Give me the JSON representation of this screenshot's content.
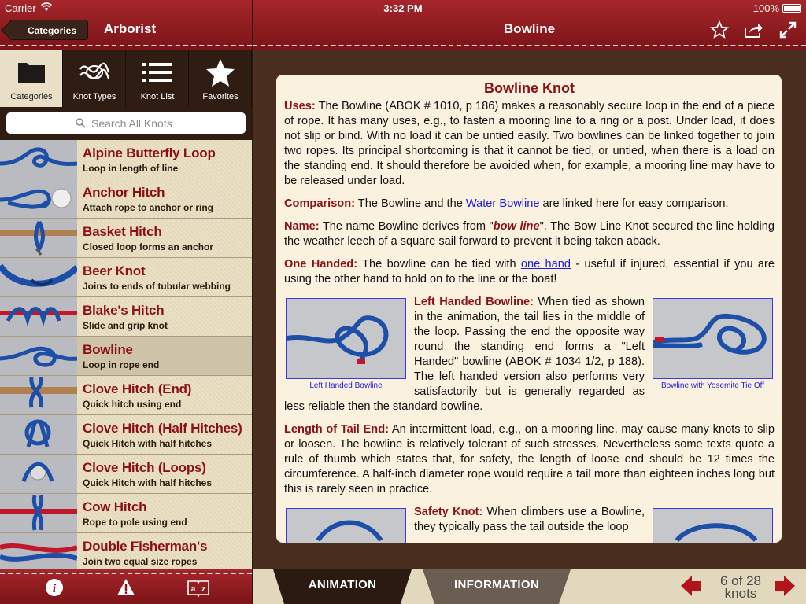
{
  "status": {
    "carrier": "Carrier",
    "time": "3:32 PM",
    "battery": "100%"
  },
  "left_nav": {
    "back_label": "Categories",
    "title": "Arborist"
  },
  "right_nav": {
    "title": "Bowline"
  },
  "tabs": [
    {
      "label": "Categories",
      "icon": "folder-icon"
    },
    {
      "label": "Knot Types",
      "icon": "knot-icon"
    },
    {
      "label": "Knot List",
      "icon": "list-icon"
    },
    {
      "label": "Favorites",
      "icon": "star-icon"
    }
  ],
  "search": {
    "placeholder": "Search All Knots"
  },
  "knots": [
    {
      "title": "Alpine Butterfly Loop",
      "subtitle": "Loop in length of line"
    },
    {
      "title": "Anchor Hitch",
      "subtitle": "Attach rope to anchor or ring"
    },
    {
      "title": "Basket Hitch",
      "subtitle": "Closed loop forms an anchor"
    },
    {
      "title": "Beer Knot",
      "subtitle": "Joins to ends of tubular webbing"
    },
    {
      "title": "Blake's Hitch",
      "subtitle": "Slide and grip knot"
    },
    {
      "title": "Bowline",
      "subtitle": "Loop in rope end"
    },
    {
      "title": "Clove Hitch (End)",
      "subtitle": "Quick hitch using end"
    },
    {
      "title": "Clove Hitch (Half Hitches)",
      "subtitle": "Quick Hitch with half hitches"
    },
    {
      "title": "Clove Hitch (Loops)",
      "subtitle": "Quick Hitch with half hitches"
    },
    {
      "title": "Cow Hitch",
      "subtitle": "Rope to pole using end"
    },
    {
      "title": "Double Fisherman's",
      "subtitle": "Join two equal size ropes"
    }
  ],
  "content": {
    "heading": "Bowline Knot",
    "uses_label": "Uses:",
    "uses_text": " The Bowline (ABOK # 1010, p 186) makes a reasonably secure loop in the end of a piece of rope. It has many uses, e.g., to fasten a mooring line to a ring or a post. Under load, it does not slip or bind. With no load it can be untied easily. Two bowlines can be linked together to join two ropes. Its principal shortcoming is that it cannot be tied, or untied, when there is a load on the standing end. It should therefore be avoided when, for example, a mooring line may have to be released under load.",
    "comparison_label": "Comparison:",
    "comparison_pre": " The Bowline and the ",
    "comparison_link": "Water Bowline",
    "comparison_post": " are linked here for easy comparison.",
    "name_label": "Name:",
    "name_pre": " The name Bowline derives from \"",
    "name_em": "bow line",
    "name_post": "\". The Bow Line Knot secured the line holding the weather leech of a square sail forward to prevent it being taken aback.",
    "onehand_label": "One Handed:",
    "onehand_pre": " The bowline can be tied with ",
    "onehand_link": "one hand",
    "onehand_post": " - useful if injured, essential if you are using the other hand to hold on to the line or the boat!",
    "fig1_caption": "Left Handed Bowline",
    "fig2_caption": "Bowline with Yosemite Tie Off",
    "lefthanded_label": "Left Handed Bowline:",
    "lefthanded_text": " When tied as shown in the animation, the tail lies in the middle of the loop. Passing the end the opposite way round the standing end forms a \"Left Handed\" bowline (ABOK # 1034 1/2, p 188). The left handed version also performs very satisfactorily but is generally regarded as less reliable then the standard bowline.",
    "tail_label": "Length of Tail End:",
    "tail_text": " An intermittent load, e.g., on a mooring line, may cause many knots to slip or loosen. The bowline is relatively tolerant of such stresses. Nevertheless some texts quote a rule of thumb which states that, for safety, the length of loose end should be 12 times the circumference. A half-inch diameter rope would require a tail more than eighteen inches long but this is rarely seen in practice.",
    "safety_label": "Safety Knot:",
    "safety_text": " When climbers use a Bowline, they typically pass the tail outside the loop"
  },
  "bottom": {
    "animation_tab": "ANIMATION",
    "information_tab": "INFORMATION",
    "counter_line1": "6 of 28",
    "counter_line2": "knots"
  },
  "colors": {
    "brand_red": "#8b1016",
    "nav_red": "#a5262b",
    "link_blue": "#1a1ad8",
    "card_bg": "#fbf1df"
  }
}
